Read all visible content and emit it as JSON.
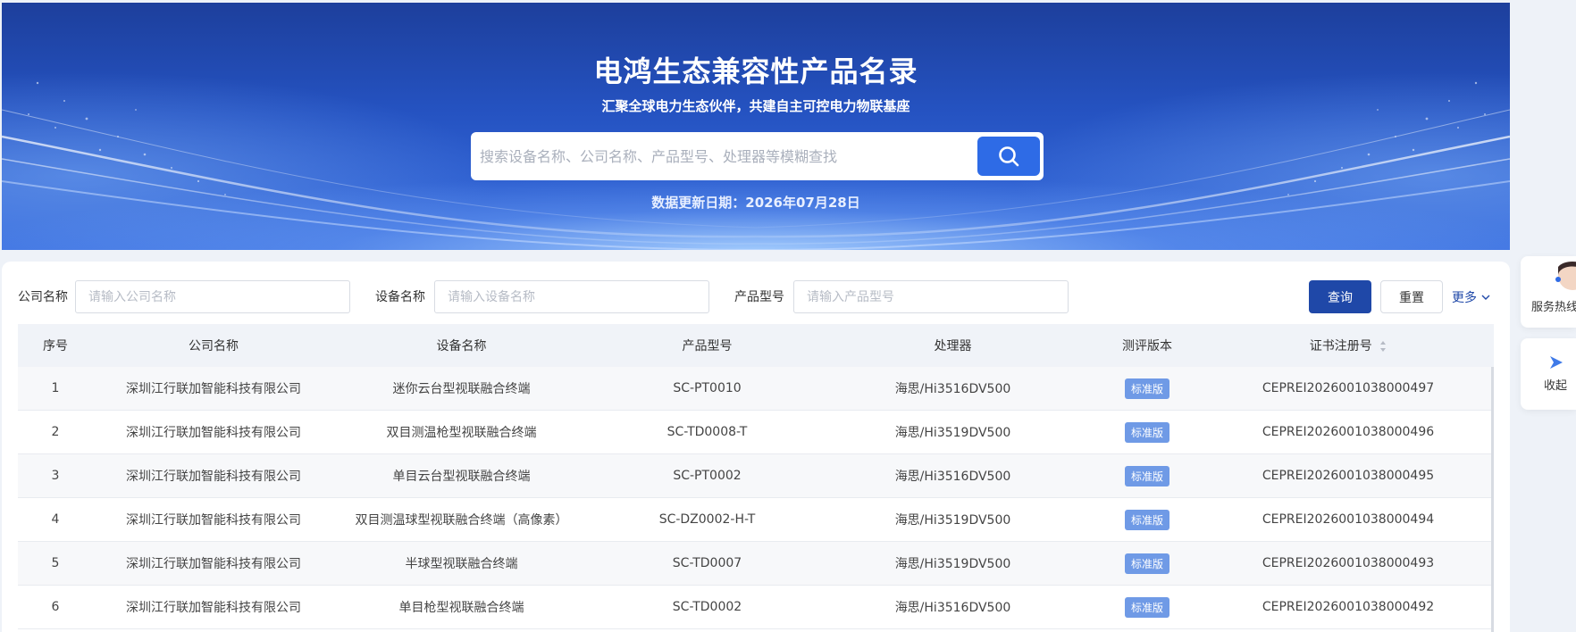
{
  "banner": {
    "title": "电鸿生态兼容性产品名录",
    "subtitle": "汇聚全球电力生态伙伴，共建自主可控电力物联基座",
    "search_placeholder": "搜索设备名称、公司名称、产品型号、处理器等模糊查找",
    "search_icon": "search-icon",
    "update_date": "数据更新日期：2026年07月28日"
  },
  "filters": {
    "company_label": "公司名称",
    "company_placeholder": "请输入公司名称",
    "device_label": "设备名称",
    "device_placeholder": "请输入设备名称",
    "model_label": "产品型号",
    "model_placeholder": "请输入产品型号",
    "query_label": "查询",
    "reset_label": "重置",
    "more_label": "更多"
  },
  "table": {
    "headers": [
      "序号",
      "公司名称",
      "设备名称",
      "产品型号",
      "处理器",
      "测评版本",
      "证书注册号"
    ],
    "rows": [
      {
        "no": "1",
        "company": "深圳江行联加智能科技有限公司",
        "device": "迷你云台型视联融合终端",
        "model": "SC-PT0010",
        "processor": "海思/Hi3516DV500",
        "version": "标准版",
        "cert": "CEPREI2026001038000497"
      },
      {
        "no": "2",
        "company": "深圳江行联加智能科技有限公司",
        "device": "双目测温枪型视联融合终端",
        "model": "SC-TD0008-T",
        "processor": "海思/Hi3519DV500",
        "version": "标准版",
        "cert": "CEPREI2026001038000496"
      },
      {
        "no": "3",
        "company": "深圳江行联加智能科技有限公司",
        "device": "单目云台型视联融合终端",
        "model": "SC-PT0002",
        "processor": "海思/Hi3516DV500",
        "version": "标准版",
        "cert": "CEPREI2026001038000495"
      },
      {
        "no": "4",
        "company": "深圳江行联加智能科技有限公司",
        "device": "双目测温球型视联融合终端（高像素）",
        "model": "SC-DZ0002-H-T",
        "processor": "海思/Hi3519DV500",
        "version": "标准版",
        "cert": "CEPREI2026001038000494"
      },
      {
        "no": "5",
        "company": "深圳江行联加智能科技有限公司",
        "device": "半球型视联融合终端",
        "model": "SC-TD0007",
        "processor": "海思/Hi3519DV500",
        "version": "标准版",
        "cert": "CEPREI2026001038000493"
      },
      {
        "no": "6",
        "company": "深圳江行联加智能科技有限公司",
        "device": "单目枪型视联融合终端",
        "model": "SC-TD0002",
        "processor": "海思/Hi3516DV500",
        "version": "标准版",
        "cert": "CEPREI2026001038000492"
      }
    ]
  },
  "side": {
    "hotline_label": "服务热线",
    "collapse_label": "收起"
  },
  "colors": {
    "primary": "#1f48a8",
    "search_button": "#2e6be6",
    "badge": "#6f9ae6"
  }
}
